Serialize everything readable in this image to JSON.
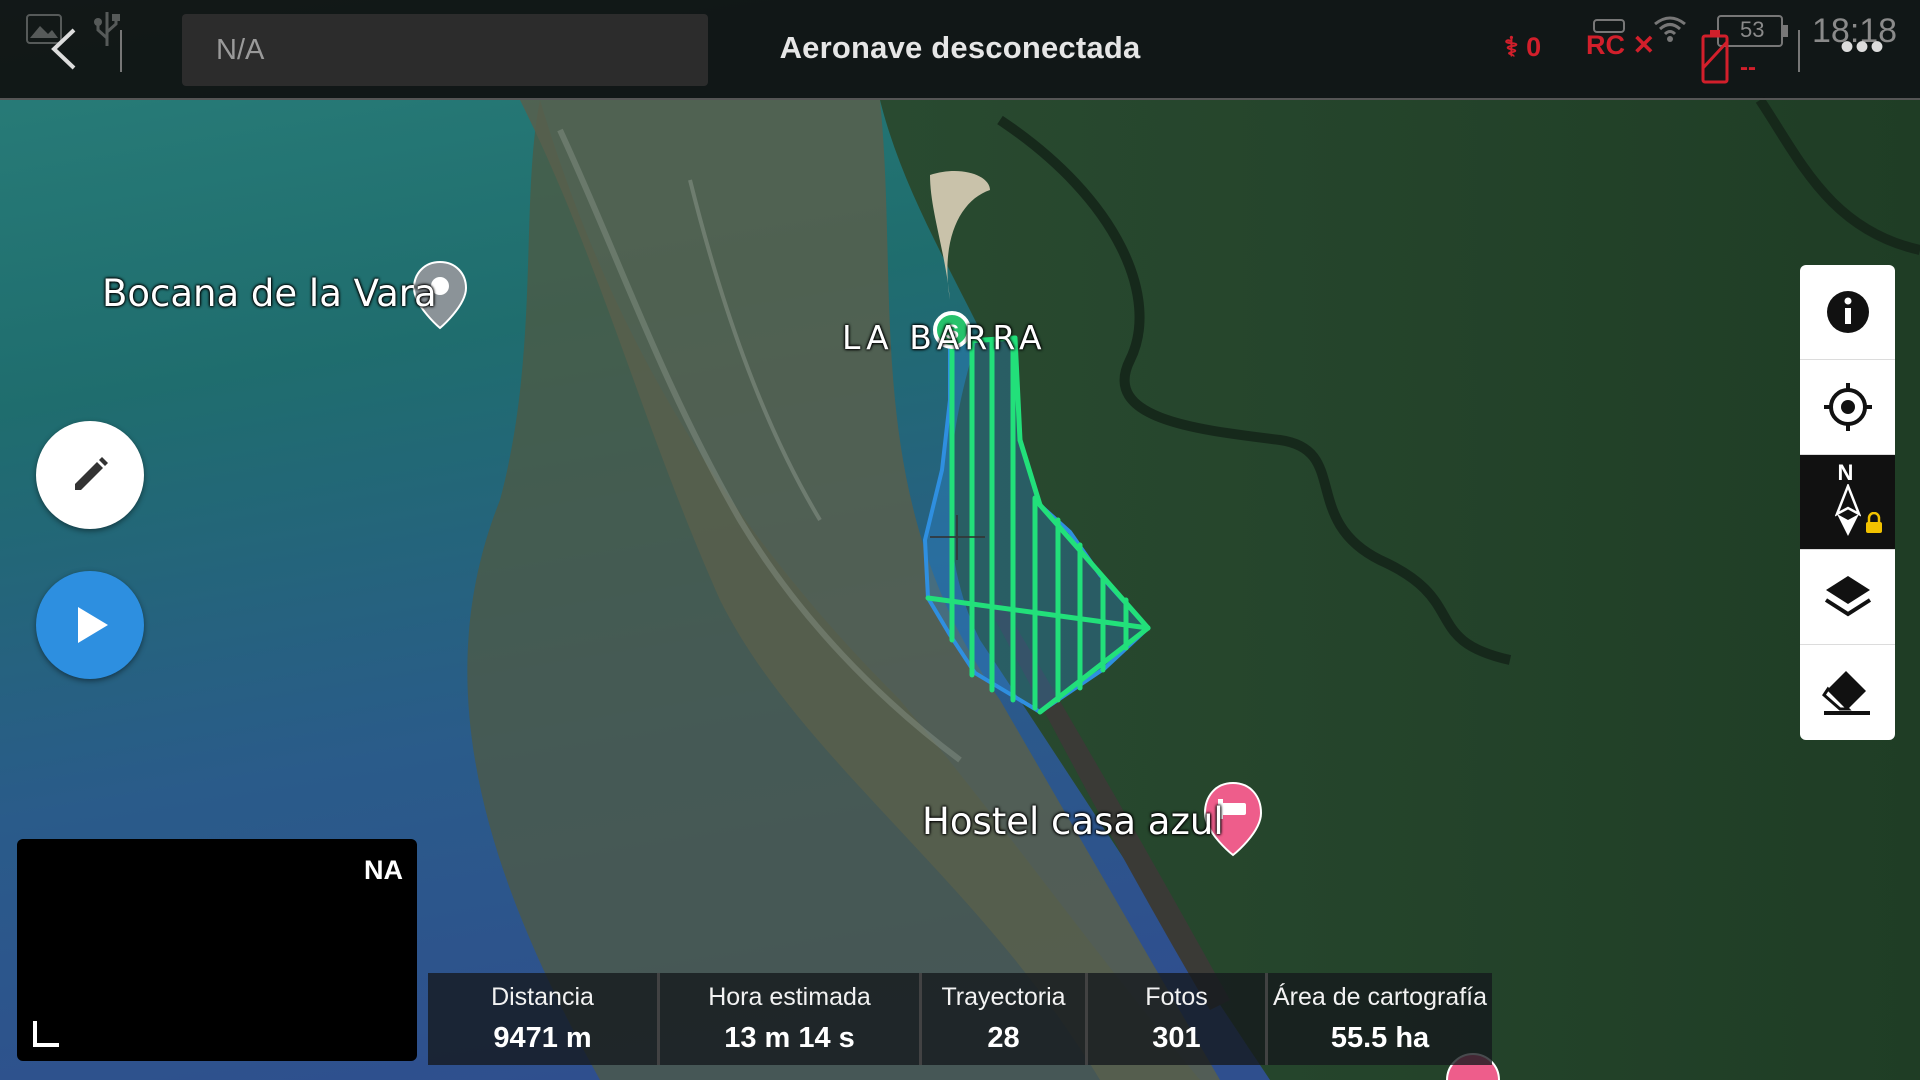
{
  "topbar": {
    "back_icon": "chevron-left-icon",
    "search_value": "N/A",
    "status_title": "Aeronave desconectada",
    "drone_signal": "0",
    "rc_label": "RC",
    "battery_level": "53",
    "battery_text": "--",
    "time": "18:18",
    "colors": {
      "alert": "#d21f2b"
    }
  },
  "map": {
    "labels": {
      "bocana": "Bocana de la Vara",
      "labarra": "LA BARRA",
      "hostel": "Hostel casa azul"
    },
    "mission": {
      "start_marker": "S",
      "line_color": "#22e07a",
      "area_color": "#2f8fe0"
    }
  },
  "left_buttons": {
    "edit_icon": "pencil-icon",
    "play_icon": "play-icon"
  },
  "tools": [
    "info-icon",
    "locate-icon",
    "compass-north-locked-icon",
    "layers-icon",
    "eraser-icon"
  ],
  "compass": {
    "north_label": "N"
  },
  "mini_view": {
    "label": "NA"
  },
  "stats": [
    {
      "label": "Distancia",
      "value": "9471 m"
    },
    {
      "label": "Hora estimada",
      "value": "13 m 14 s"
    },
    {
      "label": "Trayectoria",
      "value": "28"
    },
    {
      "label": "Fotos",
      "value": "301"
    },
    {
      "label": "Área de cartografía",
      "value": "55.5 ha"
    }
  ]
}
